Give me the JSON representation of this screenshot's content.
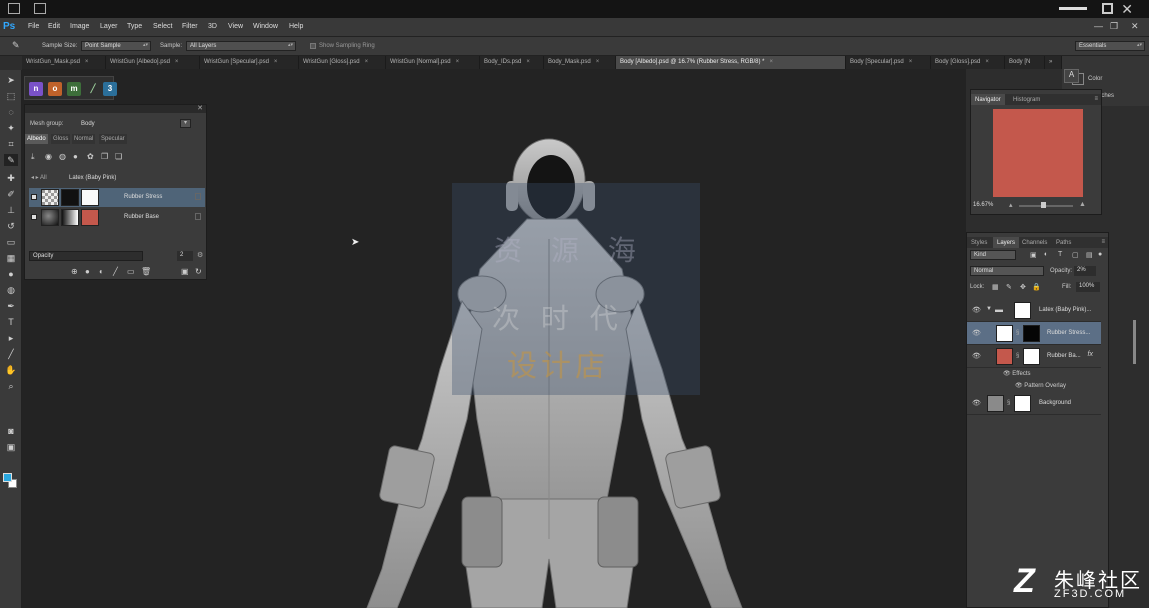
{
  "app": {
    "logo": "Ps",
    "menus": [
      "File",
      "Edit",
      "Image",
      "Layer",
      "Type",
      "Select",
      "Filter",
      "3D",
      "View",
      "Window",
      "Help"
    ],
    "window_controls": {
      "minimize": "—",
      "maximize": "❐",
      "close": "✕"
    }
  },
  "options": {
    "sample_size_label": "Sample Size:",
    "sample_size_value": "Point Sample",
    "sample_label": "Sample:",
    "sample_value": "All Layers",
    "show_ring_label": "Show Sampling Ring",
    "workspace": "Essentials"
  },
  "tabs": [
    {
      "label": "WristGun_Mask.psd",
      "active": false
    },
    {
      "label": "WristGun [Albedo].psd",
      "active": false
    },
    {
      "label": "WristGun [Specular].psd",
      "active": false
    },
    {
      "label": "WristGun [Gloss].psd",
      "active": false
    },
    {
      "label": "WristGun [Normal].psd",
      "active": false
    },
    {
      "label": "Body_IDs.psd",
      "active": false
    },
    {
      "label": "Body_Mask.psd",
      "active": false
    },
    {
      "label": "Body [Albedo].psd @ 16.7% (Rubber Stress, RGB/8) *",
      "active": true
    },
    {
      "label": "Body [Specular].psd",
      "active": false
    },
    {
      "label": "Body [Gloss].psd",
      "active": false
    },
    {
      "label": "Body [N",
      "active": false
    }
  ],
  "tabs_overflow": "»",
  "canvas": {
    "watermark_line1": "资 源 海",
    "watermark_line2": "次 时 代",
    "watermark_line3": "设计店"
  },
  "texture_panel": {
    "mesh_group_label": "Mesh group:",
    "mesh_group_value": "Body",
    "channels": [
      "Albedo",
      "Gloss",
      "Normal",
      "Specular"
    ],
    "active_channel": "Albedo",
    "material_nav": "◂  ▸  All",
    "material_name": "Latex (Baby Pink)",
    "layers": [
      {
        "name": "Rubber Stress",
        "selected": true
      },
      {
        "name": "Rubber Base",
        "selected": false
      }
    ],
    "opacity_label": "Opacity",
    "opacity_value": "2"
  },
  "navigator": {
    "tabs": [
      "Navigator",
      "Histogram"
    ],
    "zoom": "16.67%",
    "preview_color": "#c4584c"
  },
  "mini_panels": {
    "color_label": "Color",
    "swatches_label": "Swatches"
  },
  "layers_panel": {
    "tabs": [
      "Styles",
      "Layers",
      "Channels",
      "Paths"
    ],
    "active_tab": "Layers",
    "kind": "Kind",
    "blend_mode": "Normal",
    "opacity_label": "Opacity:",
    "opacity_value": "2%",
    "lock_label": "Lock:",
    "fill_label": "Fill:",
    "fill_value": "100%",
    "rows": [
      {
        "name": "Latex (Baby Pink)...",
        "type": "group",
        "selected": false
      },
      {
        "name": "Rubber Stress...",
        "type": "layer",
        "selected": true
      },
      {
        "name": "Rubber Ba...",
        "type": "layer",
        "selected": false,
        "fx": "fx"
      },
      {
        "name": "Background",
        "type": "layer",
        "selected": false
      }
    ],
    "effects_label": "Effects",
    "pattern_overlay_label": "Pattern Overlay"
  },
  "site_watermark": {
    "logo": "Z",
    "cn": "朱峰社区",
    "en": "ZF3D.COM"
  },
  "colors": {
    "foreground": "#29a8e0",
    "background": "#ffffff",
    "albedo_swatch": "#c4584c"
  }
}
